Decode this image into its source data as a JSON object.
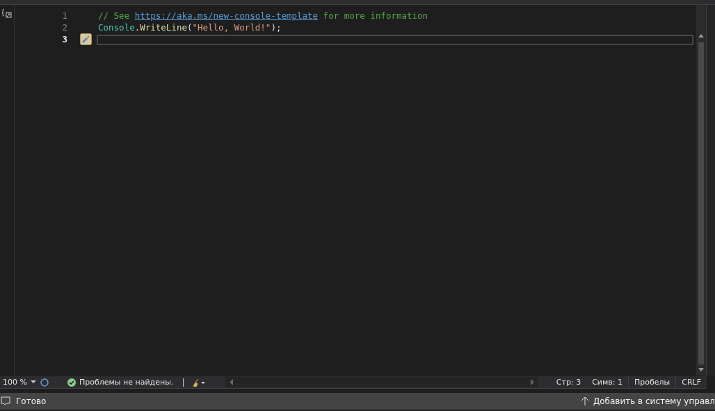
{
  "editor": {
    "lines": [
      {
        "number": "1",
        "current": false,
        "tokens": [
          {
            "kind": "comment",
            "text": "// See "
          },
          {
            "kind": "link",
            "text": "https://aka.ms/new-console-template"
          },
          {
            "kind": "comment",
            "text": " for more information"
          }
        ]
      },
      {
        "number": "2",
        "current": false,
        "tokens": [
          {
            "kind": "type",
            "text": "Console"
          },
          {
            "kind": "plain",
            "text": "."
          },
          {
            "kind": "method",
            "text": "WriteLine"
          },
          {
            "kind": "plain",
            "text": "("
          },
          {
            "kind": "string",
            "text": "\"Hello, World!\""
          },
          {
            "kind": "plain",
            "text": ");"
          }
        ]
      },
      {
        "number": "3",
        "current": true
      }
    ]
  },
  "editor_status": {
    "zoom": "100 %",
    "problems": "Проблемы не найдены.",
    "line": "Стр: 3",
    "column": "Симв: 1",
    "indent": "Пробелы",
    "line_ending": "CRLF"
  },
  "status_bar": {
    "state": "Готово",
    "source_control": "Добавить в систему управл"
  }
}
